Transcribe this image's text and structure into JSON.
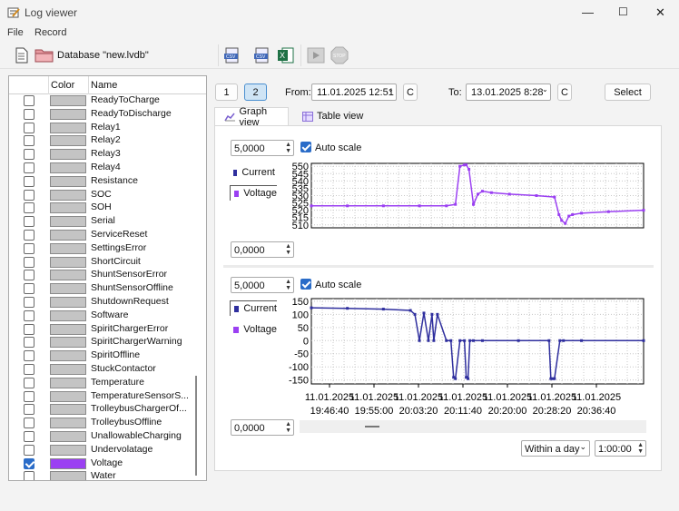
{
  "window": {
    "title": "Log viewer",
    "minimize": "—",
    "maximize": "☐",
    "close": "✕"
  },
  "menu": [
    "File",
    "Record"
  ],
  "toolbar": {
    "database_label": "Database \"new.lvdb\""
  },
  "list": {
    "headers": {
      "color": "Color",
      "name": "Name"
    },
    "items": [
      {
        "name": "ReadyToCharge",
        "checked": false
      },
      {
        "name": "ReadyToDischarge",
        "checked": false
      },
      {
        "name": "Relay1",
        "checked": false
      },
      {
        "name": "Relay2",
        "checked": false
      },
      {
        "name": "Relay3",
        "checked": false
      },
      {
        "name": "Relay4",
        "checked": false
      },
      {
        "name": "Resistance",
        "checked": false
      },
      {
        "name": "SOC",
        "checked": false
      },
      {
        "name": "SOH",
        "checked": false
      },
      {
        "name": "Serial",
        "checked": false
      },
      {
        "name": "ServiceReset",
        "checked": false
      },
      {
        "name": "SettingsError",
        "checked": false
      },
      {
        "name": "ShortCircuit",
        "checked": false
      },
      {
        "name": "ShuntSensorError",
        "checked": false
      },
      {
        "name": "ShuntSensorOffline",
        "checked": false
      },
      {
        "name": "ShutdownRequest",
        "checked": false
      },
      {
        "name": "Software",
        "checked": false
      },
      {
        "name": "SpiritChargerError",
        "checked": false
      },
      {
        "name": "SpiritChargerWarning",
        "checked": false
      },
      {
        "name": "SpiritOffline",
        "checked": false
      },
      {
        "name": "StuckContactor",
        "checked": false
      },
      {
        "name": "Temperature",
        "checked": false
      },
      {
        "name": "TemperatureSensorS...",
        "checked": false
      },
      {
        "name": "TrolleybusChargerOf...",
        "checked": false
      },
      {
        "name": "TrolleybusOffline",
        "checked": false
      },
      {
        "name": "UnallowableCharging",
        "checked": false
      },
      {
        "name": "Undervolatage",
        "checked": false
      },
      {
        "name": "Voltage",
        "checked": true,
        "color": "#9b40f2"
      },
      {
        "name": "Water",
        "checked": false
      }
    ]
  },
  "controls": {
    "page1": "1",
    "page2": "2",
    "from_label": "From:",
    "from_value": "11.01.2025 12:51",
    "to_label": "To:",
    "to_value": "13.01.2025 8:28",
    "clear": "C",
    "select": "Select"
  },
  "tabs": {
    "graph": "Graph view",
    "table": "Table view"
  },
  "chart1": {
    "max": "5,0000",
    "min": "0,0000",
    "autoscale": "Auto scale",
    "legend": [
      {
        "name": "Current",
        "color": "#2f2f9e"
      },
      {
        "name": "Voltage",
        "color": "#9b40f2"
      }
    ]
  },
  "chart2": {
    "max": "5,0000",
    "min": "0,0000",
    "autoscale": "Auto scale",
    "legend": [
      {
        "name": "Current",
        "color": "#2f2f9e"
      },
      {
        "name": "Voltage",
        "color": "#9b40f2"
      }
    ]
  },
  "bottom": {
    "range": "Within a day",
    "step": "1:00:00"
  },
  "chart_data": [
    {
      "type": "line",
      "series": [
        {
          "name": "Voltage",
          "color": "#9b40f2",
          "x": [
            0,
            40,
            80,
            120,
            150,
            160,
            165,
            170,
            172,
            175,
            180,
            185,
            190,
            200,
            220,
            250,
            270,
            275,
            278,
            282,
            286,
            290,
            300,
            330,
            369
          ],
          "values": [
            523,
            523,
            523,
            523,
            523,
            524,
            550,
            551,
            551,
            548,
            524,
            531,
            533,
            532,
            531,
            530,
            529,
            517,
            513,
            511,
            516,
            517,
            518,
            519,
            520
          ]
        }
      ],
      "yticks": [
        550,
        545,
        540,
        535,
        530,
        525,
        520,
        515,
        510
      ],
      "ylim": [
        508,
        552
      ]
    },
    {
      "type": "line",
      "series": [
        {
          "name": "Current",
          "color": "#2f2f9e",
          "x": [
            0,
            40,
            80,
            110,
            115,
            120,
            125,
            130,
            134,
            136,
            140,
            150,
            155,
            158,
            160,
            165,
            170,
            172,
            174,
            176,
            180,
            190,
            230,
            264,
            266,
            268,
            270,
            276,
            280,
            300,
            369
          ],
          "values": [
            125,
            123,
            120,
            115,
            100,
            0,
            105,
            0,
            100,
            0,
            100,
            0,
            0,
            -140,
            -145,
            0,
            0,
            -140,
            -145,
            0,
            0,
            0,
            0,
            0,
            -145,
            -145,
            -145,
            0,
            0,
            0,
            0
          ]
        }
      ],
      "yticks": [
        150,
        100,
        50,
        0,
        -50,
        -100,
        -150
      ],
      "ylim": [
        -165,
        160
      ],
      "xticks": [
        "11.01.2025\n19:46:40",
        "11.01.2025\n19:55:00",
        "11.01.2025\n20:03:20",
        "11.01.2025\n20:11:40",
        "11.01.2025\n20:20:00",
        "11.01.2025\n20:28:20",
        "11.01.2025\n20:36:40"
      ]
    }
  ]
}
